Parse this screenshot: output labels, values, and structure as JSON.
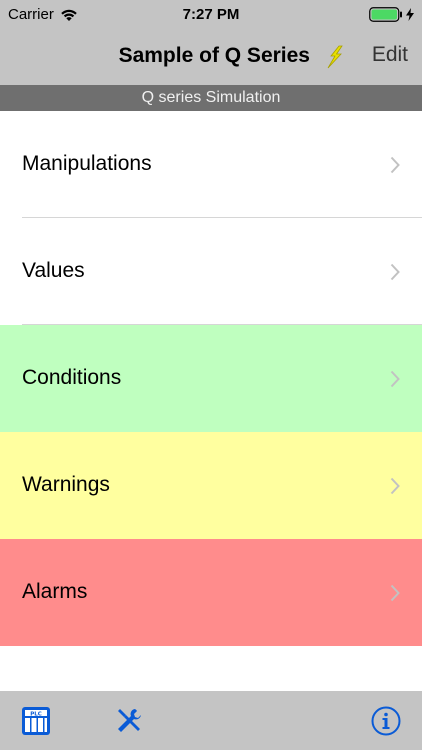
{
  "status_bar": {
    "carrier": "Carrier",
    "time": "7:27 PM"
  },
  "nav_bar": {
    "title": "Sample of Q Series",
    "edit_label": "Edit"
  },
  "section_header": {
    "title": "Q series Simulation"
  },
  "menu": {
    "items": [
      {
        "label": "Manipulations",
        "bg": "#ffffff"
      },
      {
        "label": "Values",
        "bg": "#ffffff"
      },
      {
        "label": "Conditions",
        "bg": "#bfffbf"
      },
      {
        "label": "Warnings",
        "bg": "#ffff9f"
      },
      {
        "label": "Alarms",
        "bg": "#ff8c8c"
      }
    ]
  },
  "colors": {
    "bar_gray": "#c4c4c4",
    "section_gray": "#6f6f6f",
    "accent_blue": "#0a5bd6",
    "lightning_yellow": "#e8e000",
    "battery_green": "#4cd964"
  },
  "tab_bar": {
    "icons": [
      "plc-icon",
      "tools-icon",
      "info-icon"
    ]
  }
}
